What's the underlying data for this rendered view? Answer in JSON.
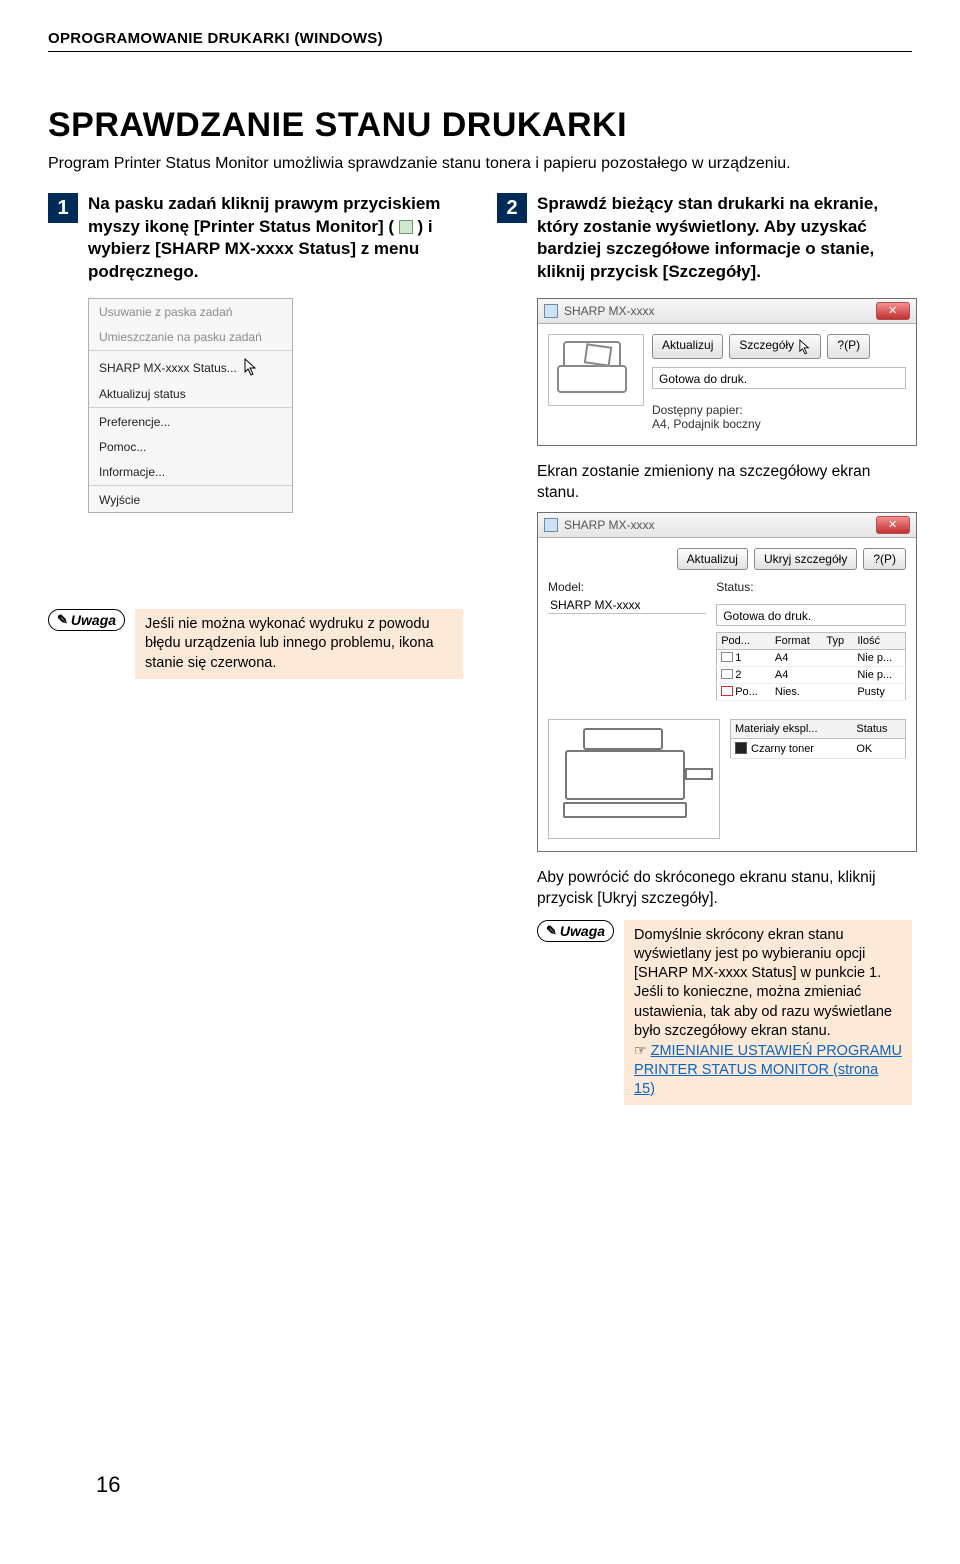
{
  "header": {
    "breadcrumb": "OPROGRAMOWANIE DRUKARKI (WINDOWS)"
  },
  "title": "SPRAWDZANIE STANU DRUKARKI",
  "intro": "Program Printer Status Monitor umożliwia sprawdzanie stanu tonera i papieru pozostałego w urządzeniu.",
  "step1": {
    "num": "1",
    "text_before": "Na pasku zadań kliknij prawym przyciskiem myszy ikonę [Printer Status Monitor] (",
    "text_after": ") i wybierz [SHARP MX-xxxx Status] z menu podręcznego."
  },
  "step2": {
    "num": "2",
    "text": "Sprawdź bieżący stan drukarki na ekranie, który zostanie wyświetlony. Aby uzyskać bardziej szczegółowe informacje o stanie, kliknij przycisk [Szczegóły]."
  },
  "context_menu": {
    "items": [
      "Usuwanie z paska zadań",
      "Umieszczanie na pasku zadań",
      "SHARP MX-xxxx Status...",
      "Aktualizuj status",
      "Preferencje...",
      "Pomoc...",
      "Informacje...",
      "Wyjście"
    ]
  },
  "note1": {
    "label": "Uwaga",
    "text": "Jeśli nie można wykonać wydruku z powodu błędu urządzenia lub innego problemu, ikona stanie się czerwona."
  },
  "small_win": {
    "title": "SHARP MX-xxxx",
    "btn_refresh": "Aktualizuj",
    "btn_details": "Szczegóły",
    "btn_help": "?(P)",
    "status_line": "Gotowa do druk.",
    "paper_label": "Dostępny papier:",
    "paper_value": "A4, Podajnik boczny"
  },
  "col2_intro": "Ekran zostanie zmieniony na szczegółowy ekran stanu.",
  "big_win": {
    "title": "SHARP MX-xxxx",
    "btn_refresh": "Aktualizuj",
    "btn_hide": "Ukryj szczegóły",
    "btn_help": "?(P)",
    "lbl_model": "Model:",
    "val_model": "SHARP MX-xxxx",
    "lbl_status": "Status:",
    "val_status": "Gotowa do druk.",
    "trays": {
      "headers": [
        "Pod...",
        "Format",
        "Typ",
        "Ilość"
      ],
      "rows": [
        {
          "icon": "tray",
          "pod": "1",
          "format": "A4",
          "typ": "",
          "ilosc": "Nie p..."
        },
        {
          "icon": "tray",
          "pod": "2",
          "format": "A4",
          "typ": "",
          "ilosc": "Nie p..."
        },
        {
          "icon": "tray-open",
          "pod": "Po...",
          "format": "Nies.",
          "typ": "",
          "ilosc": "Pusty"
        }
      ]
    },
    "supplies": {
      "headers": [
        "Materiały ekspl...",
        "Status"
      ],
      "rows": [
        {
          "name": "Czarny toner",
          "status": "OK"
        }
      ]
    }
  },
  "after_big": "Aby powrócić do skróconego ekranu stanu, kliknij przycisk [Ukryj szczegóły].",
  "note2": {
    "label": "Uwaga",
    "text": "Domyślnie skrócony ekran stanu wyświetlany jest po wybieraniu opcji [SHARP MX-xxxx Status] w punkcie 1. Jeśli to konieczne, można zmieniać ustawienia, tak aby od razu wyświetlane było szczegółowy ekran stanu.",
    "link": "ZMIENIANIE USTAWIEŃ PROGRAMU PRINTER STATUS MONITOR (strona 15)"
  },
  "page_number": "16"
}
